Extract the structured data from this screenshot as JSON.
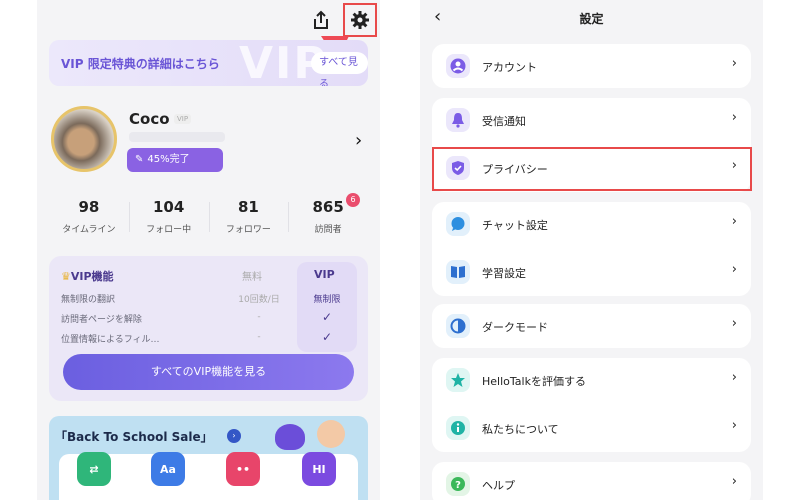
{
  "left": {
    "vip_banner": {
      "text": "VIP 限定特典の詳細はこちら",
      "watermark": "VIP",
      "see_button": "すべて見る"
    },
    "profile": {
      "name": "Coco",
      "vip_chip": "VIP",
      "progress": "45%完了"
    },
    "stats": [
      {
        "value": "98",
        "label": "タイムライン"
      },
      {
        "value": "104",
        "label": "フォロー中"
      },
      {
        "value": "81",
        "label": "フォロワー"
      },
      {
        "value": "865",
        "label": "訪問者",
        "badge": "6"
      }
    ],
    "vip_features": {
      "header": "VIP機能",
      "free_col": "無料",
      "vip_col": "VIP",
      "rows": [
        {
          "feature": "無制限の翻訳",
          "free": "10回数/日",
          "vip": "無制限"
        },
        {
          "feature": "訪問者ページを解除",
          "free": "-",
          "vip": "✓"
        },
        {
          "feature": "位置情報によるフィル…",
          "free": "-",
          "vip": "✓"
        }
      ],
      "cta": "すべてのVIP機能を見る"
    },
    "sale": {
      "title": "「Back To School Sale」"
    },
    "apps": [
      "Aa",
      "HI"
    ]
  },
  "right": {
    "title": "設定",
    "items": [
      {
        "label": "アカウント",
        "icon": "account-icon"
      },
      {
        "label": "受信通知",
        "icon": "bell-icon"
      },
      {
        "label": "プライバシー",
        "icon": "shield-icon"
      },
      {
        "label": "チャット設定",
        "icon": "chat-icon"
      },
      {
        "label": "学習設定",
        "icon": "book-icon"
      },
      {
        "label": "ダークモード",
        "icon": "dark-mode-icon"
      },
      {
        "label": "HelloTalkを評価する",
        "icon": "star-icon"
      },
      {
        "label": "私たちについて",
        "icon": "info-icon"
      },
      {
        "label": "ヘルプ",
        "icon": "help-icon"
      }
    ]
  },
  "colors": {
    "accent": "#7b5ce6",
    "highlight_box": "#e84a4a"
  }
}
